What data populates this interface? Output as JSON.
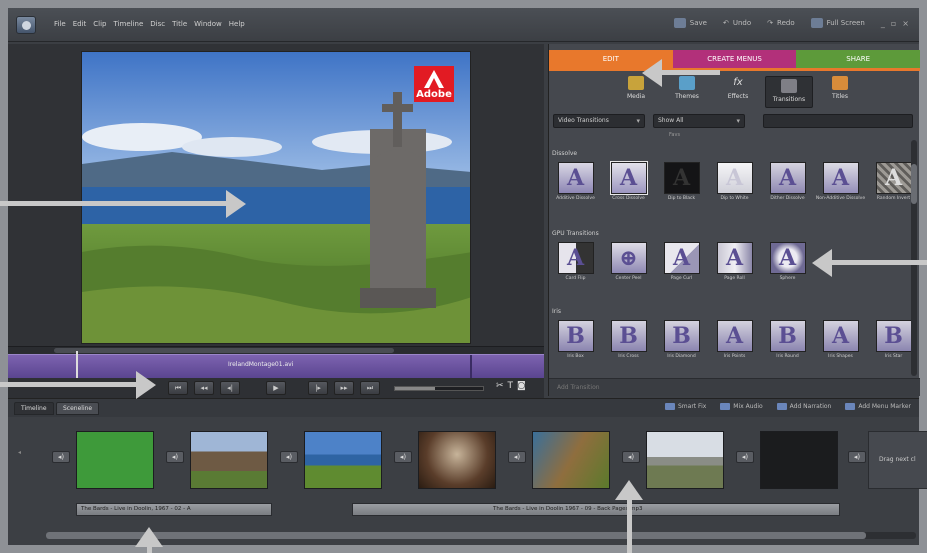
{
  "menubar": {
    "items": [
      "File",
      "Edit",
      "Clip",
      "Timeline",
      "Disc",
      "Title",
      "Window",
      "Help"
    ],
    "right": {
      "save": "Save",
      "undo": "Undo",
      "redo": "Redo",
      "fullscreen": "Full Screen"
    }
  },
  "monitor": {
    "logo_text": "Adobe",
    "clip_label": "IrelandMontage01.avi",
    "transport": [
      "⏮",
      "◂◂",
      "◂|",
      "▶",
      "|▸",
      "▸▸",
      "⏭"
    ]
  },
  "panel": {
    "tabs": [
      {
        "label": "EDIT",
        "color": "#e8782c"
      },
      {
        "label": "CREATE MENUS",
        "color": "#b2307a"
      },
      {
        "label": "SHARE",
        "color": "#5d9a3a"
      }
    ],
    "subtools": [
      "Media",
      "Themes",
      "Effects",
      "Transitions",
      "Titles"
    ],
    "filter_type": "Video Transitions",
    "filter_show": "Show All",
    "hint": "Favs",
    "categories": [
      {
        "name": "Dissolve",
        "items": [
          "Additive Dissolve",
          "Cross Dissolve",
          "Dip to Black",
          "Dip to White",
          "Dither Dissolve",
          "Non-Additive Dissolve",
          "Random Invert"
        ]
      },
      {
        "name": "GPU Transitions",
        "items": [
          "Card Flip",
          "Center Peel",
          "Page Curl",
          "Page Roll",
          "Sphere"
        ]
      },
      {
        "name": "Iris",
        "items": [
          "Iris Box",
          "Iris Cross",
          "Iris Diamond",
          "Iris Points",
          "Iris Round",
          "Iris Shapes",
          "Iris Star"
        ]
      }
    ],
    "apply_label": "Add Transition"
  },
  "timeline": {
    "tabs": [
      "Timeline",
      "Sceneline"
    ],
    "tools": [
      "Smart Fix",
      "Mix Audio",
      "Add Narration",
      "Add Menu Marker"
    ],
    "drop_text": "Drag next cl",
    "audio_clips": [
      "The Bards - Live in Doolin, 1967 - 02 - A",
      "The Bards - Live in Doolin 1967 - 09 - Back Pages.mp3"
    ]
  }
}
